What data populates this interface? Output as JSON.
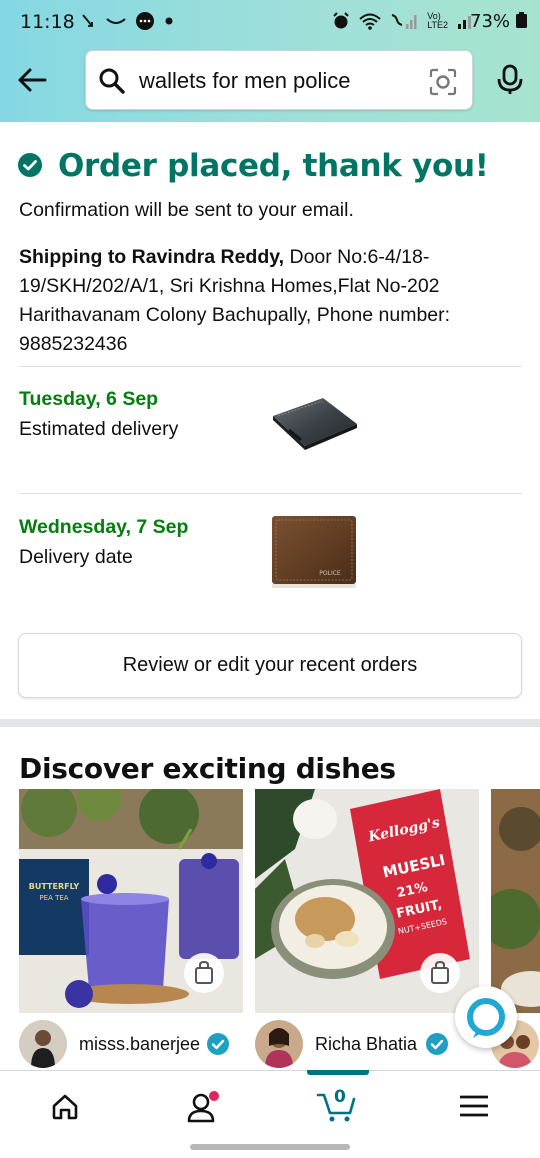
{
  "status_bar": {
    "time": "11:18",
    "battery": "73%",
    "left_icons": [
      "call-forward-icon",
      "voicemail-icon",
      "chat-bubble-icon",
      "dot-icon"
    ],
    "right_icons": [
      "alarm-icon",
      "wifi-icon",
      "signal-icon",
      "signal-icon"
    ],
    "network_label": "Vo) LTE2"
  },
  "header": {
    "search_query": "wallets for men police"
  },
  "order": {
    "title": "Order placed, thank you!",
    "confirmation": "Confirmation will be sent to your email.",
    "shipping_label": "Shipping to Ravindra Reddy,",
    "shipping_address": " Door No:6-4/18-19/SKH/202/A/1, Sri Krishna Homes,Flat No-202 Harithavanam Colony Bachupally, Phone number: 9885232436",
    "deliveries": [
      {
        "date": "Tuesday, 6 Sep",
        "note": "Estimated delivery"
      },
      {
        "date": "Wednesday, 7 Sep",
        "note": "Delivery date"
      }
    ],
    "product_print": "POLICE",
    "review_button": "Review or edit your recent orders"
  },
  "discover": {
    "title": "Discover exciting dishes",
    "creators": [
      {
        "name": "misss.banerjee",
        "image_text": [
          "BUTTERFLY",
          "PEA TEA"
        ]
      },
      {
        "name": "Richa Bhatia",
        "image_text": [
          "Kellogg's",
          "MUESLI",
          "21%",
          "FRUIT,",
          "NUT+SEEDS"
        ]
      }
    ]
  },
  "bottom_nav": {
    "items": [
      "home-icon",
      "account-icon",
      "cart-icon",
      "menu-icon"
    ],
    "cart_count": "0"
  },
  "colors": {
    "success_green": "#007563",
    "date_green": "#067d10",
    "cart_teal": "#007185",
    "notification_pink": "#e0245e"
  }
}
